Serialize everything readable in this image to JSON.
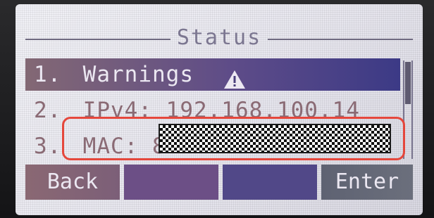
{
  "screen": {
    "title": "Status"
  },
  "menu": {
    "items": [
      {
        "number": "1.",
        "label": "Warnings",
        "icon": "warning-triangle-icon",
        "selected": true
      },
      {
        "number": "2.",
        "label": "IPv4: 192.168.100.14",
        "selected": false
      },
      {
        "number": "3.",
        "label": "MAC: 8",
        "selected": false,
        "value_redacted": true
      }
    ]
  },
  "softkeys": {
    "back": "Back",
    "key2": "",
    "key3": "",
    "enter": "Enter"
  },
  "colors": {
    "highlight_box": "#e5473c",
    "selection": "#5e4c88"
  }
}
